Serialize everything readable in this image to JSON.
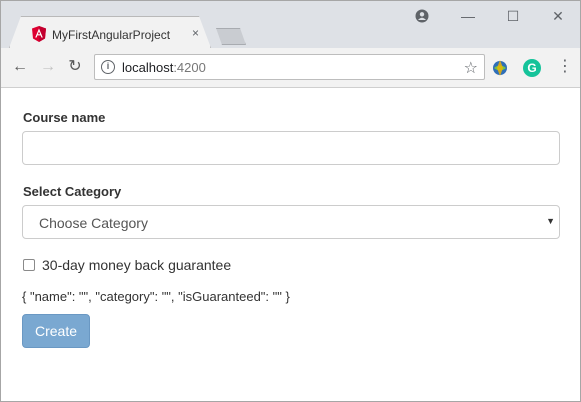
{
  "browser": {
    "tab_title": "MyFirstAngularProject",
    "tab_close": "×",
    "url_host": "localhost",
    "url_port": ":4200",
    "favicon": "angular-logo-icon",
    "controls": {
      "profile": "●",
      "minimize": "—",
      "maximize": "☐",
      "close": "✕"
    },
    "nav": {
      "back": "←",
      "forward": "→",
      "reload": "↻",
      "info": "i",
      "star": "☆",
      "menu": "⋮",
      "grammarly": "G"
    }
  },
  "form": {
    "course_label": "Course name",
    "course_value": "",
    "category_label": "Select Category",
    "category_selected": "Choose Category",
    "caret": "▼",
    "guarantee_label": "30-day money back guarantee",
    "guarantee_checked": false,
    "json_output": "{ \"name\": \"\", \"category\": \"\", \"isGuaranteed\": \"\" }",
    "create_label": "Create"
  },
  "colors": {
    "angular_red": "#dd0031",
    "button_disabled": "#7aa8d1",
    "grammarly_green": "#15c39a"
  }
}
